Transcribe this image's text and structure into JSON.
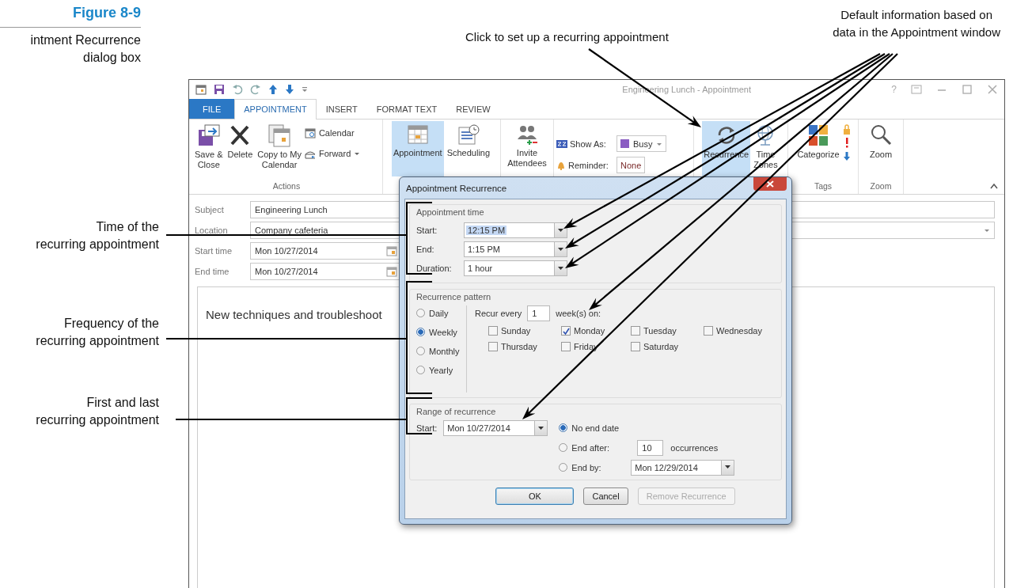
{
  "figure": {
    "number": "Figure 8-9",
    "caption": "intment Recurrence\ndialog box"
  },
  "callouts_top": [
    "Click to set up a recurring appointment",
    "Default information based on\ndata in the Appointment window"
  ],
  "callouts_left": [
    "Time of the\nrecurring appointment",
    "Frequency of the\nrecurring appointment",
    "First and last\nrecurring appointment"
  ],
  "window": {
    "title": "Engineering Lunch - Appointment",
    "help": "?",
    "tabs": [
      {
        "label": "FILE",
        "kind": "file",
        "selected": false
      },
      {
        "label": "APPOINTMENT",
        "kind": "tab",
        "selected": true
      },
      {
        "label": "INSERT",
        "kind": "tab",
        "selected": false
      },
      {
        "label": "FORMAT TEXT",
        "kind": "tab",
        "selected": false
      },
      {
        "label": "REVIEW",
        "kind": "tab",
        "selected": false
      }
    ]
  },
  "ribbon": {
    "save_close": "Save &\nClose",
    "delete": "Delete",
    "copy": "Copy to My\nCalendar",
    "calendar": "Calendar",
    "forward": "Forward",
    "actions_label": "Actions",
    "views": [
      {
        "label": "Appointment",
        "selected": true
      },
      {
        "label": "Scheduling",
        "selected": false
      }
    ],
    "invite": "Invite\nAttendees",
    "show_as": {
      "label": "Show As:",
      "value": "Busy"
    },
    "reminder": {
      "label": "Reminder:",
      "value": "None"
    },
    "recurrence": {
      "label": "Recurrence",
      "selected": true
    },
    "time_zones": "Time\nZones",
    "categorize": "Categorize",
    "tags_label": "Tags",
    "zoom": "Zoom",
    "zoom_label": "Zoom"
  },
  "form": [
    {
      "label": "Subject",
      "value": "Engineering Lunch",
      "kind": "text"
    },
    {
      "label": "Location",
      "value": "Company cafeteria",
      "kind": "dropdown"
    },
    {
      "label": "Start time",
      "value": "Mon 10/27/2014",
      "kind": "date"
    },
    {
      "label": "End time",
      "value": "Mon 10/27/2014",
      "kind": "date"
    }
  ],
  "body": "New techniques and troubleshoot",
  "dialog": {
    "title": "Appointment Recurrence",
    "time": {
      "heading": "Appointment time",
      "rows": [
        {
          "label": "Start:",
          "value": "12:15 PM",
          "selected": true
        },
        {
          "label": "End:",
          "value": "1:15 PM",
          "selected": false
        },
        {
          "label": "Duration:",
          "value": "1 hour",
          "selected": false
        }
      ]
    },
    "pattern": {
      "heading": "Recurrence pattern",
      "options": [
        {
          "label": "Daily",
          "selected": false
        },
        {
          "label": "Weekly",
          "selected": true
        },
        {
          "label": "Monthly",
          "selected": false
        },
        {
          "label": "Yearly",
          "selected": false
        }
      ],
      "recur_label": "Recur every",
      "recur_value": "1",
      "recur_suffix": "week(s) on:",
      "days": [
        {
          "label": "Sunday",
          "checked": false
        },
        {
          "label": "Monday",
          "checked": true
        },
        {
          "label": "Tuesday",
          "checked": false
        },
        {
          "label": "Wednesday",
          "checked": false
        },
        {
          "label": "Thursday",
          "checked": false
        },
        {
          "label": "Friday",
          "checked": false
        },
        {
          "label": "Saturday",
          "checked": false
        }
      ]
    },
    "range": {
      "heading": "Range of recurrence",
      "start_label": "Start:",
      "start_value": "Mon 10/27/2014",
      "ends": [
        {
          "label": "No end date",
          "selected": true,
          "kind": "none"
        },
        {
          "label": "End after:",
          "selected": false,
          "kind": "after",
          "value": "10",
          "suffix": "occurrences"
        },
        {
          "label": "End by:",
          "selected": false,
          "kind": "by",
          "value": "Mon 12/29/2014"
        }
      ]
    },
    "buttons": [
      {
        "label": "OK",
        "kind": "default"
      },
      {
        "label": "Cancel",
        "kind": "normal"
      },
      {
        "label": "Remove Recurrence",
        "kind": "disabled"
      }
    ]
  }
}
